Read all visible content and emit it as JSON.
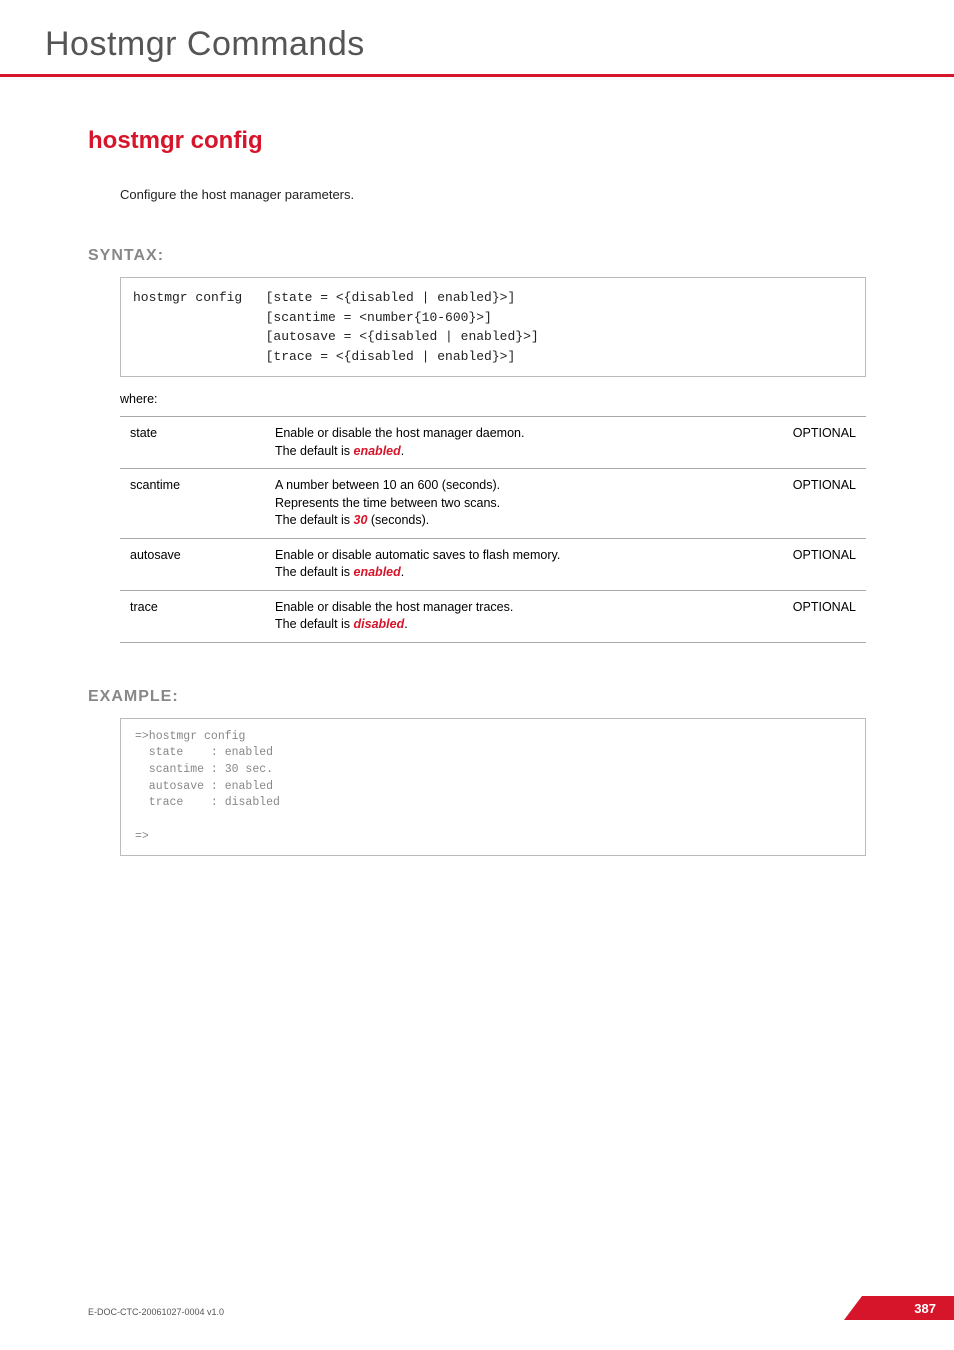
{
  "page": {
    "title": "Hostmgr Commands",
    "section_heading": "hostmgr config",
    "description": "Configure the host manager parameters.",
    "syntax_label": "SYNTAX:",
    "syntax_cmd": "hostmgr config",
    "syntax_args": "[state = <{disabled | enabled}>]\n[scantime = <number{10-600}>]\n[autosave = <{disabled | enabled}>]\n[trace = <{disabled | enabled}>]",
    "where_label": "where:",
    "params": [
      {
        "name": "state",
        "desc_line1": "Enable or disable the host manager daemon.",
        "desc_prefix": "The default is ",
        "desc_emph": "enabled",
        "desc_suffix": ".",
        "extra_line": "",
        "flag": "OPTIONAL"
      },
      {
        "name": "scantime",
        "desc_line1": "A number between 10 an 600 (seconds).",
        "extra_line": "Represents the time between two scans.",
        "desc_prefix": "The default is ",
        "desc_emph": "30",
        "desc_suffix": " (seconds).",
        "flag": "OPTIONAL"
      },
      {
        "name": "autosave",
        "desc_line1": "Enable or disable automatic saves to flash memory.",
        "extra_line": "",
        "desc_prefix": "The default is ",
        "desc_emph": "enabled",
        "desc_suffix": ".",
        "flag": "OPTIONAL"
      },
      {
        "name": "trace",
        "desc_line1": "Enable or disable the host manager traces.",
        "extra_line": "",
        "desc_prefix": "The default is ",
        "desc_emph": "disabled",
        "desc_suffix": ".",
        "flag": "OPTIONAL"
      }
    ],
    "example_label": "EXAMPLE:",
    "example_text": "=>hostmgr config\n  state    : enabled\n  scantime : 30 sec.\n  autosave : enabled\n  trace    : disabled\n\n=>",
    "doc_id": "E-DOC-CTC-20061027-0004 v1.0",
    "page_number": "387"
  }
}
